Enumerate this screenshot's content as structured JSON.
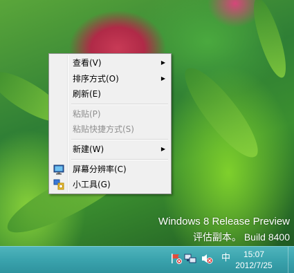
{
  "desktop": {
    "watermark_line1": "Windows 8 Release Preview",
    "watermark_line2": "评估副本。 Build 8400"
  },
  "context_menu": {
    "items": [
      {
        "label": "查看(V)",
        "submenu": true,
        "enabled": true
      },
      {
        "label": "排序方式(O)",
        "submenu": true,
        "enabled": true
      },
      {
        "label": "刷新(E)",
        "submenu": false,
        "enabled": true
      },
      {
        "label": "粘贴(P)",
        "submenu": false,
        "enabled": false
      },
      {
        "label": "粘贴快捷方式(S)",
        "submenu": false,
        "enabled": false
      },
      {
        "label": "新建(W)",
        "submenu": true,
        "enabled": true
      },
      {
        "label": "屏幕分辨率(C)",
        "submenu": false,
        "enabled": true,
        "icon": "monitor-icon"
      },
      {
        "label": "小工具(G)",
        "submenu": false,
        "enabled": true,
        "icon": "gadgets-icon"
      }
    ],
    "submenu_arrow": "▶"
  },
  "taskbar": {
    "tray_icons": [
      "action-center-flag-icon",
      "network-icon",
      "volume-muted-icon"
    ],
    "ime_label": "中",
    "clock_time": "15:07",
    "clock_date": "2012/7/25",
    "accent_color": "#3aa3ad"
  }
}
